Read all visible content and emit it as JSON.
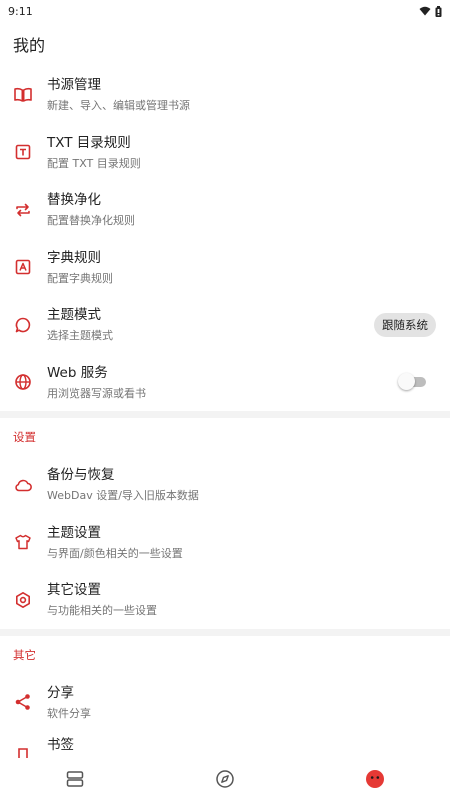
{
  "status_bar": {
    "time": "9:11"
  },
  "page": {
    "title": "我的"
  },
  "top_items": [
    {
      "title": "书源管理",
      "summary": "新建、导入、编辑或管理书源"
    },
    {
      "title": "TXT 目录规则",
      "summary": "配置 TXT 目录规则"
    },
    {
      "title": "替换净化",
      "summary": "配置替换净化规则"
    },
    {
      "title": "字典规则",
      "summary": "配置字典规则"
    },
    {
      "title": "主题模式",
      "summary": "选择主题模式",
      "value": "跟随系统"
    },
    {
      "title": "Web 服务",
      "summary": "用浏览器写源或看书",
      "switch_on": false
    }
  ],
  "settings_section": {
    "header": "设置",
    "items": [
      {
        "title": "备份与恢复",
        "summary": "WebDav 设置/导入旧版本数据"
      },
      {
        "title": "主题设置",
        "summary": "与界面/颜色相关的一些设置"
      },
      {
        "title": "其它设置",
        "summary": "与功能相关的一些设置"
      }
    ]
  },
  "other_section": {
    "header": "其它",
    "items": [
      {
        "title": "分享",
        "summary": "软件分享"
      },
      {
        "title": "书签",
        "summary": ""
      }
    ]
  },
  "colors": {
    "accent": "#d32f2f",
    "text_primary": "#222222",
    "text_secondary": "#757575",
    "divider": "#f3f3f3"
  },
  "icons": [
    "book-open-icon",
    "txt-rule-icon",
    "swap-arrows-icon",
    "dictionary-icon",
    "theme-bubble-icon",
    "globe-icon",
    "cloud-icon",
    "tshirt-icon",
    "gear-icon",
    "share-icon",
    "bookmark-icon",
    "bookshelf-icon",
    "compass-icon",
    "profile-icon"
  ]
}
